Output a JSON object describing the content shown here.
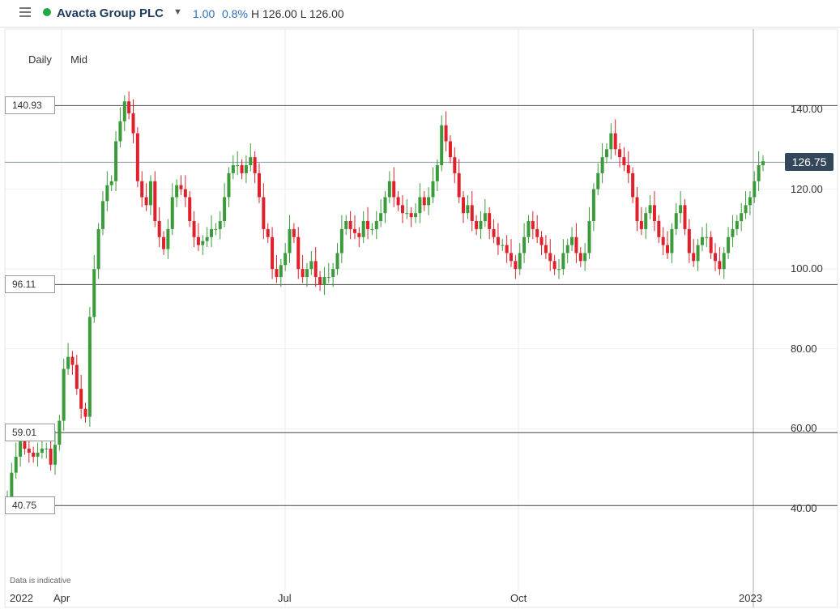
{
  "header": {
    "instrument": "Avacta Group PLC",
    "change": "1.00",
    "change_pct": "0.8%",
    "high_low": "H 126.00  L 126.00",
    "dropdown_icon": "▼"
  },
  "timeframe": {
    "interval": "Daily",
    "price_type": "Mid"
  },
  "disclaimer": "Data is indicative",
  "colors": {
    "up": "#3b9b3b",
    "down": "#e0202a",
    "status": "#22a745",
    "accent": "#2a6ebb"
  },
  "chart_data": {
    "type": "candlestick",
    "y_axis": {
      "ticks": [
        "140.00",
        "120.00",
        "100.00",
        "80.00",
        "60.00",
        "40.00"
      ],
      "range": [
        30,
        152
      ]
    },
    "x_axis": {
      "ticks": [
        "2022",
        "Apr",
        "Jul",
        "Oct",
        "2023"
      ]
    },
    "horizontal_lines": [
      {
        "label": "140.93",
        "value": 140.93
      },
      {
        "label": "96.11",
        "value": 96.11
      },
      {
        "label": "59.01",
        "value": 59.01
      },
      {
        "label": "40.75",
        "value": 40.75
      }
    ],
    "last_price": {
      "label": "126.75",
      "value": 126.75
    },
    "series_close": [
      43,
      49,
      53,
      57,
      55,
      54,
      53,
      54,
      55,
      55,
      51,
      56,
      62,
      75,
      78,
      76,
      70,
      65,
      63,
      88,
      100,
      110,
      117,
      121,
      122,
      132,
      137,
      142,
      139,
      134,
      122,
      118,
      116,
      122,
      112,
      108,
      105,
      110,
      118,
      121,
      120,
      118,
      112,
      108,
      106,
      107,
      108,
      110,
      110,
      112,
      118,
      124,
      126,
      126,
      124,
      126,
      128,
      124,
      118,
      110,
      108,
      100,
      98,
      101,
      104,
      110,
      108,
      100,
      98,
      100,
      102,
      98,
      96,
      98,
      98,
      100,
      104,
      110,
      112,
      110,
      109,
      108,
      112,
      110,
      110,
      112,
      114,
      118,
      122,
      118,
      116,
      114,
      114,
      113,
      114,
      118,
      116,
      118,
      122,
      126,
      136,
      132,
      128,
      124,
      118,
      114,
      116,
      112,
      110,
      112,
      114,
      110,
      108,
      106,
      106,
      104,
      102,
      100,
      104,
      108,
      112,
      110,
      108,
      106,
      104,
      102,
      100,
      100,
      104,
      106,
      108,
      104,
      102,
      104,
      112,
      120,
      124,
      128,
      130,
      134,
      130,
      128,
      126,
      124,
      118,
      112,
      110,
      114,
      116,
      112,
      108,
      106,
      104,
      110,
      114,
      116,
      110,
      104,
      102,
      106,
      108,
      108,
      104,
      102,
      100,
      104,
      108,
      110,
      112,
      114,
      116,
      118,
      122,
      126,
      127
    ]
  }
}
